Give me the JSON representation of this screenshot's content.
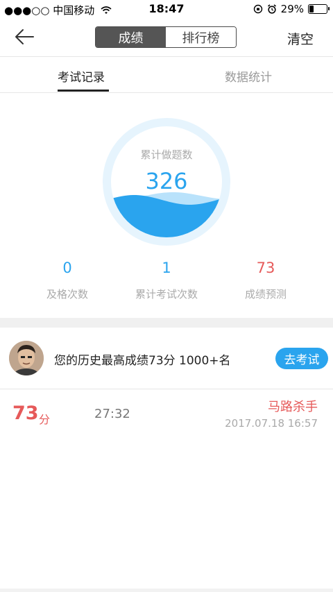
{
  "status_bar": {
    "carrier": "●●●○○ 中国移动",
    "time": "18:47",
    "battery": "29%",
    "battery_level": 0.29
  },
  "nav": {
    "segments": [
      "成绩",
      "排行榜"
    ],
    "active_segment": 0,
    "clear_label": "清空",
    "back_icon": "back-arrow-icon"
  },
  "subtabs": [
    "考试记录",
    "数据统计"
  ],
  "summary": {
    "circle_label": "累计做题数",
    "circle_value": "326",
    "fill_level": 0.5,
    "accent": "#2aa4ee",
    "stats": [
      {
        "value": "0",
        "label": "及格次数",
        "color": "#2aa4ee"
      },
      {
        "value": "1",
        "label": "累计考试次数",
        "color": "#2aa4ee"
      },
      {
        "value": "73",
        "label": "成绩预测",
        "color": "#e65a5a"
      }
    ]
  },
  "history": {
    "text": "您的历史最高成绩73分  1000+名",
    "button": "去考试"
  },
  "records": [
    {
      "score": "73",
      "unit": "分",
      "duration": "27:32",
      "title": "马路杀手",
      "date": "2017.07.18 16:57"
    }
  ]
}
